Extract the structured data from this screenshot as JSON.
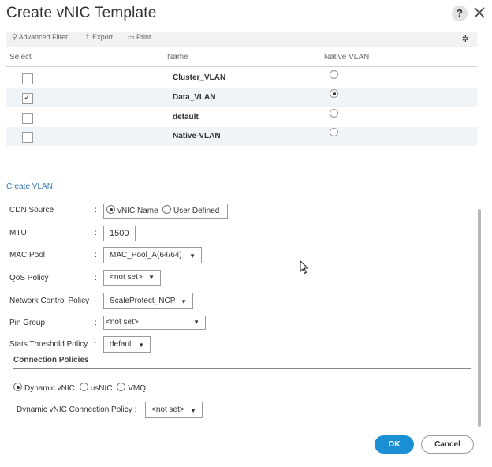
{
  "dialog": {
    "title": "Create vNIC Template",
    "help_label": "?"
  },
  "toolbar": {
    "advanced_filter": "Advanced Filter",
    "export": "Export",
    "print": "Print",
    "settings_icon": "gear-icon"
  },
  "table": {
    "columns": [
      "Select",
      "Name",
      "Native VLAN"
    ],
    "rows": [
      {
        "name": "Cluster_VLAN",
        "selected": false,
        "native": false
      },
      {
        "name": "Data_VLAN",
        "selected": true,
        "native": true
      },
      {
        "name": "default",
        "selected": false,
        "native": false
      },
      {
        "name": "Native-VLAN",
        "selected": false,
        "native": false
      }
    ]
  },
  "create_vlan_link": "Create VLAN",
  "form": {
    "cdn_source": {
      "label": "CDN Source",
      "options": [
        "vNIC Name",
        "User Defined"
      ],
      "selected": "vNIC Name"
    },
    "mtu": {
      "label": "MTU",
      "value": "1500"
    },
    "mac_pool": {
      "label": "MAC Pool",
      "value": "MAC_Pool_A(64/64)"
    },
    "qos_policy": {
      "label": "QoS Policy",
      "value": "<not set>"
    },
    "network_control_policy": {
      "label": "Network Control Policy",
      "value": "ScaleProtect_NCP"
    },
    "pin_group": {
      "label": "Pin Group",
      "value": "<not set>"
    },
    "stats_threshold_policy": {
      "label": "Stats Threshold Policy",
      "value": "default"
    }
  },
  "connection_policies": {
    "title": "Connection Policies",
    "options": [
      "Dynamic vNIC",
      "usNIC",
      "VMQ"
    ],
    "selected": "Dynamic vNIC",
    "dynamic_vnic_policy": {
      "label": "Dynamic vNIC Connection Policy :",
      "value": "<not set>"
    }
  },
  "buttons": {
    "ok": "OK",
    "cancel": "Cancel"
  },
  "colors": {
    "accent": "#1a8fd3",
    "link": "#3b78b8",
    "row_alt": "#eef4f8"
  }
}
